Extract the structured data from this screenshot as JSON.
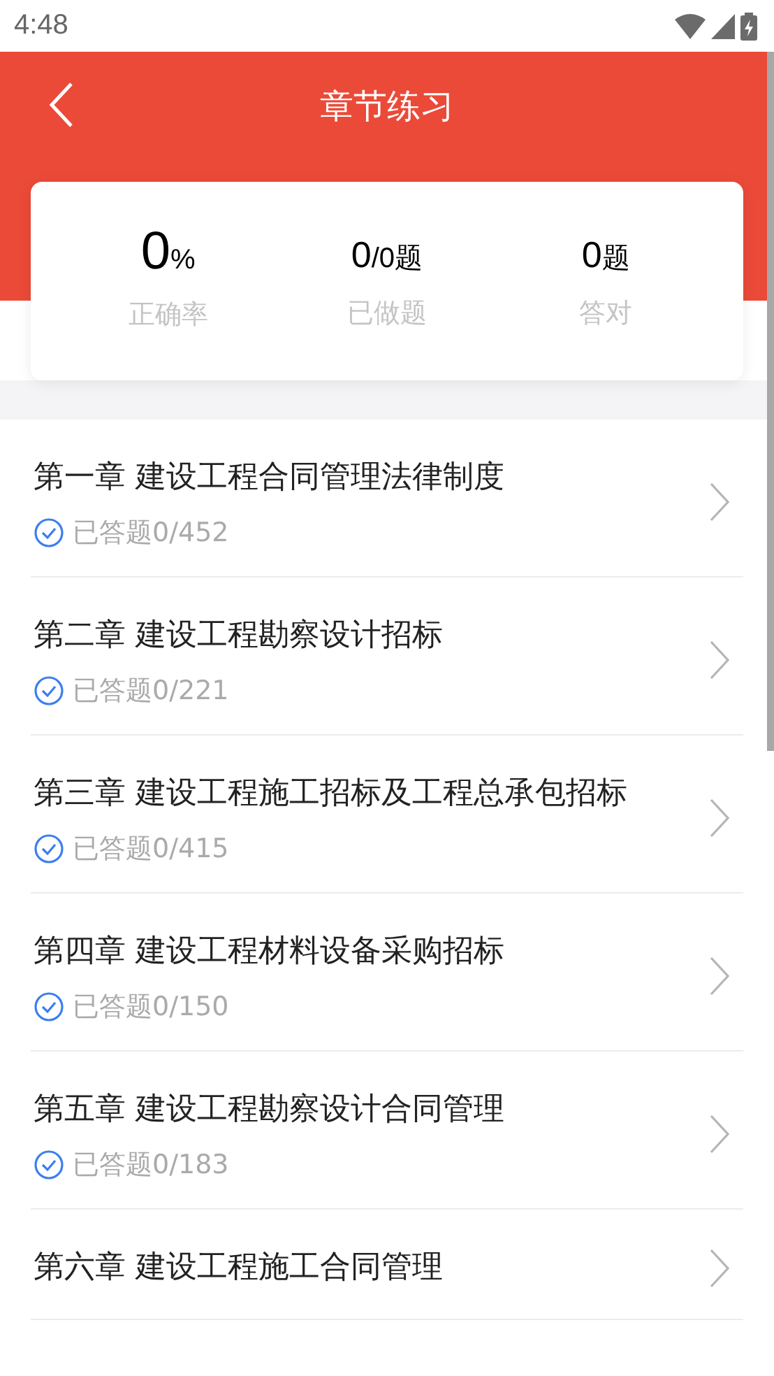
{
  "status_bar": {
    "time": "4:48"
  },
  "header": {
    "title": "章节练习"
  },
  "stats": [
    {
      "value": "0",
      "unit": "%",
      "label": "正确率"
    },
    {
      "value": "0",
      "unit": "/0题",
      "label": "已做题"
    },
    {
      "value": "0",
      "unit": "题",
      "label": "答对"
    }
  ],
  "chapters": [
    {
      "title": "第一章 建设工程合同管理法律制度",
      "progress": "已答题0/452"
    },
    {
      "title": "第二章 建设工程勘察设计招标",
      "progress": "已答题0/221"
    },
    {
      "title": "第三章 建设工程施工招标及工程总承包招标",
      "progress": "已答题0/415"
    },
    {
      "title": "第四章 建设工程材料设备采购招标",
      "progress": "已答题0/150"
    },
    {
      "title": "第五章 建设工程勘察设计合同管理",
      "progress": "已答题0/183"
    },
    {
      "title": "第六章 建设工程施工合同管理"
    }
  ]
}
